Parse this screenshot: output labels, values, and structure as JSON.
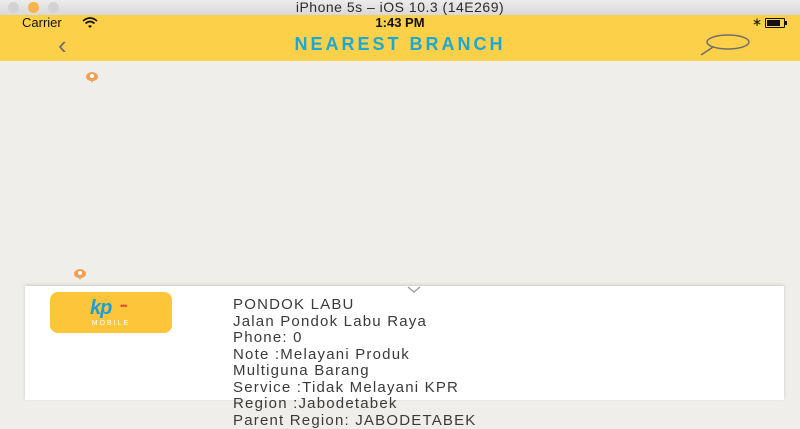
{
  "window": {
    "title": "iPhone 5s – iOS 10.3 (14E269)"
  },
  "status_bar": {
    "carrier": "Carrier",
    "time": "1:43 PM",
    "bluetooth": "∗"
  },
  "nav": {
    "back_icon": "‹",
    "title": "NEAREST BRANCH"
  },
  "colors": {
    "accent_yellow": "#fdd04a",
    "title_blue": "#1aa8d4",
    "pin_orange": "#f2a154"
  },
  "card": {
    "logo_text": "kp",
    "logo_dots": "•••",
    "logo_sub": "MOBILE",
    "lines": [
      "PONDOK LABU",
      "Jalan Pondok Labu Raya",
      "Phone: 0",
      "Note :Melayani Produk",
      "Multiguna Barang",
      "Service :Tidak Melayani KPR",
      "Region :Jabodetabek",
      "Parent Region: JABODETABEK"
    ]
  }
}
